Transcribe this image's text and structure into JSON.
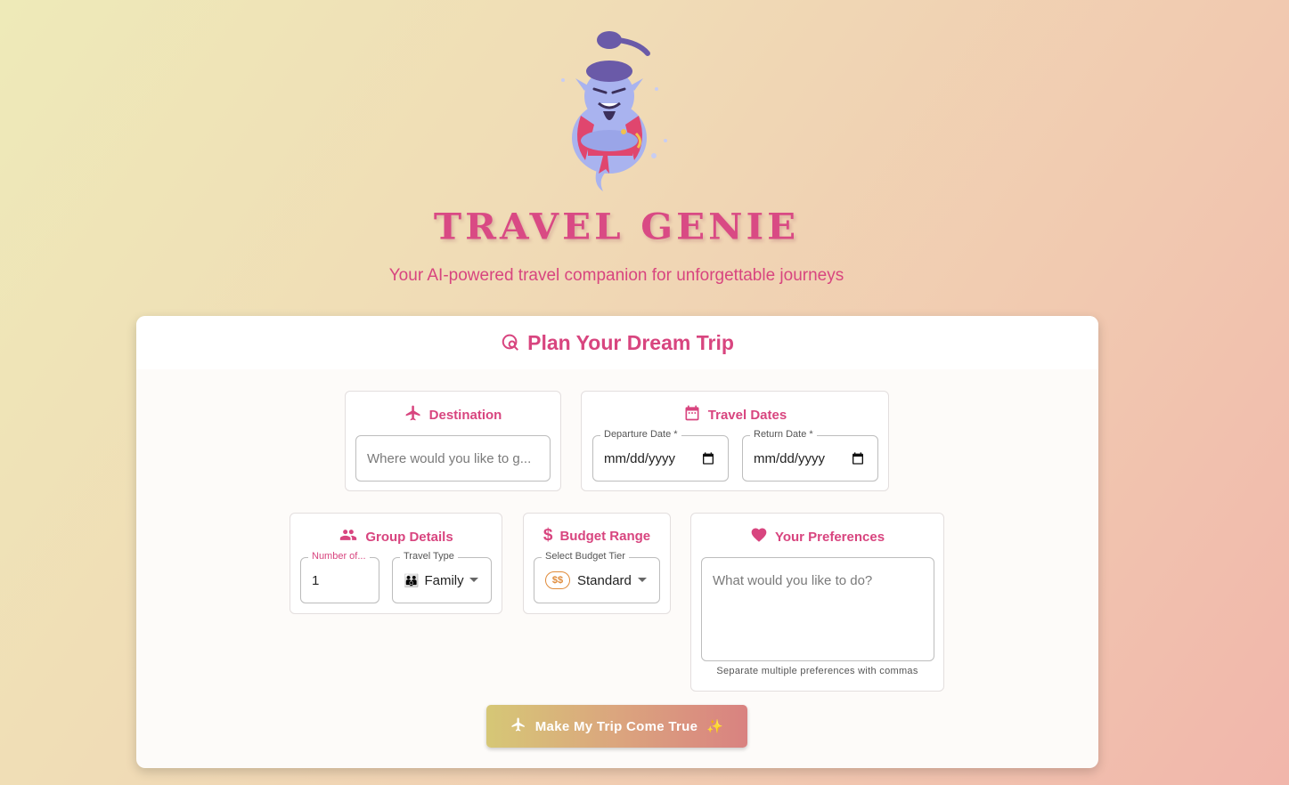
{
  "header": {
    "brand_title": "TRAVEL GENIE",
    "subtitle": "Your AI-powered travel companion for unforgettable journeys",
    "logo_icon": "genie-mascot"
  },
  "card": {
    "title": "Plan Your Dream Trip",
    "title_icon": "travel-explore-icon"
  },
  "destination": {
    "title": "Destination",
    "icon": "airplane-icon",
    "placeholder": "Where would you like to g..."
  },
  "dates": {
    "title": "Travel Dates",
    "icon": "calendar-icon",
    "departure_label": "Departure Date *",
    "departure_value": "mm/dd/yyyy",
    "return_label": "Return Date *",
    "return_value": "mm/dd/yyyy"
  },
  "group": {
    "title": "Group Details",
    "icon": "people-icon",
    "number_label": "Number of...",
    "number_value": "1",
    "type_label": "Travel Type",
    "type_value": "Family",
    "type_emoji": "👪"
  },
  "budget": {
    "title": "Budget Range",
    "icon": "dollar-icon",
    "tier_label": "Select Budget Tier",
    "tier_badge": "$$",
    "tier_value": "Standard"
  },
  "preferences": {
    "title": "Your Preferences",
    "icon": "heart-icon",
    "placeholder": "What would you like to do?",
    "helper": "Separate multiple preferences with commas"
  },
  "submit": {
    "label": "Make My Trip Come True",
    "sparkle": "✨"
  },
  "colors": {
    "accent": "#d8457f",
    "budget_badge": "#e08b3a"
  }
}
